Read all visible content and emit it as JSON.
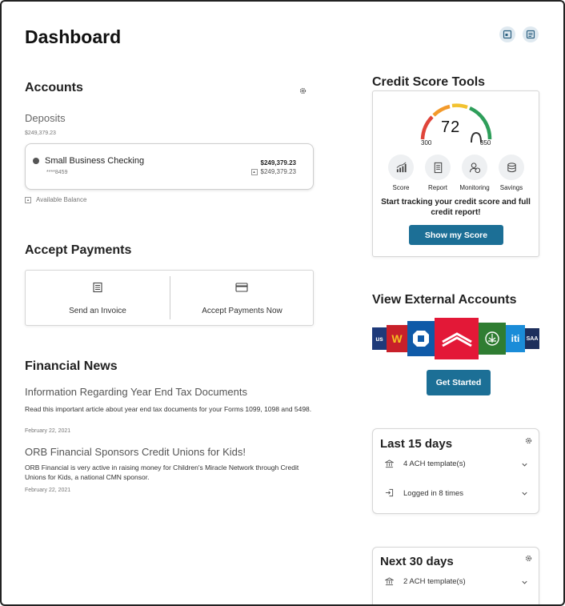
{
  "header": {
    "title": "Dashboard"
  },
  "accounts": {
    "title": "Accounts",
    "group_label": "Deposits",
    "group_total": "$249,379.23",
    "account": {
      "name": "Small Business Checking",
      "number": "****8459",
      "balance": "$249,379.23",
      "available": "$249,379.23"
    },
    "legend_label": "Available Balance"
  },
  "accept_payments": {
    "title": "Accept Payments",
    "invoice_label": "Send an Invoice",
    "accept_label": "Accept Payments Now"
  },
  "news": {
    "title": "Financial News",
    "items": [
      {
        "headline": "Information Regarding Year End Tax Documents",
        "body": "Read this important article about year end tax documents for your Forms 1099, 1098 and 5498.",
        "date": "February 22, 2021"
      },
      {
        "headline": "ORB Financial Sponsors Credit Unions for Kids!",
        "body": "ORB Financial is very active in raising money for Children's Miracle Network through Credit Unions for Kids, a national CMN sponsor.",
        "date": "February 22, 2021"
      }
    ]
  },
  "credit": {
    "title": "Credit Score Tools",
    "score_display": "72",
    "min": "300",
    "max": "850",
    "tools": [
      {
        "label": "Score",
        "icon": "bar-chart-icon"
      },
      {
        "label": "Report",
        "icon": "report-icon"
      },
      {
        "label": "Monitoring",
        "icon": "monitoring-icon"
      },
      {
        "label": "Savings",
        "icon": "savings-icon"
      }
    ],
    "message": "Start tracking your credit score and full credit report!",
    "button": "Show my Score"
  },
  "external": {
    "title": "View External Accounts",
    "logo_texts": [
      "us",
      "W",
      "iti",
      "SAA"
    ],
    "button": "Get Started"
  },
  "last15": {
    "title": "Last 15 days",
    "rows": [
      {
        "count": "4",
        "label": "ACH template(s)"
      },
      {
        "prefix": "Logged in",
        "count": "8",
        "suffix": "times"
      }
    ]
  },
  "next30": {
    "title": "Next 30 days",
    "rows": [
      {
        "count": "2",
        "label": "ACH template(s)"
      }
    ]
  },
  "colors": {
    "accent": "#1c6f96",
    "gauge_red": "#e0453a",
    "gauge_orange": "#f39a2b",
    "gauge_yellow": "#f2c230",
    "gauge_green": "#2e9e5a"
  }
}
